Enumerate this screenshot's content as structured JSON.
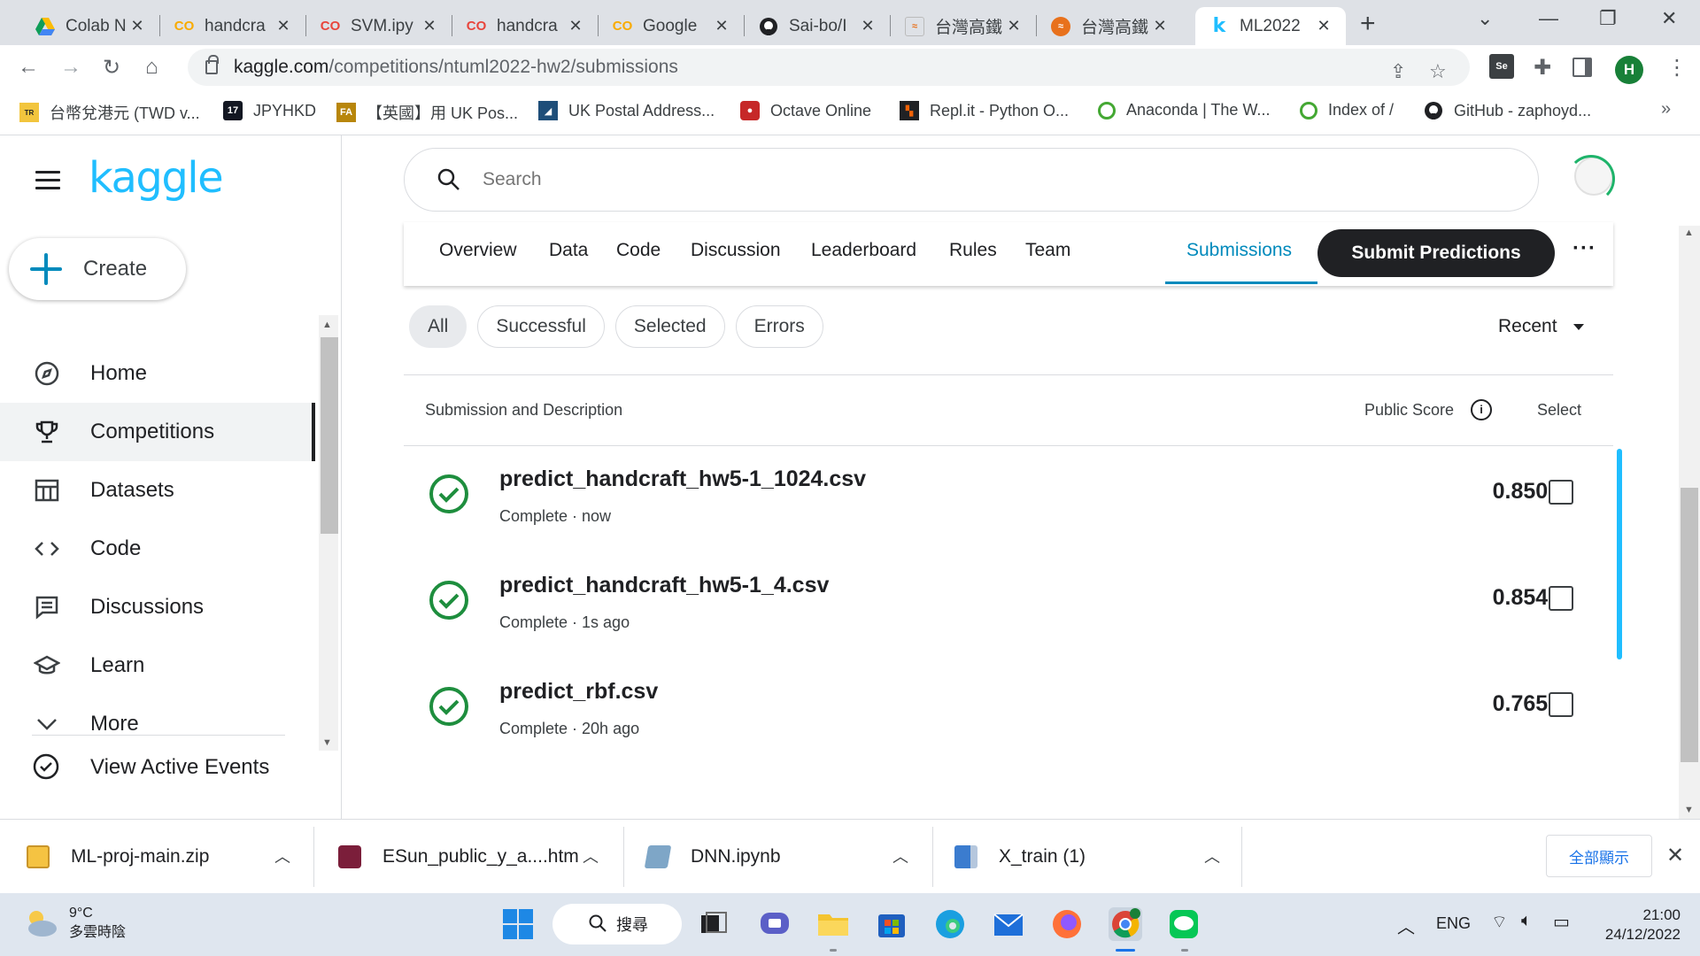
{
  "browser": {
    "tabs": [
      {
        "title": "Colab N",
        "icon": "google-drive-icon"
      },
      {
        "title": "handcra",
        "icon": "colab-icon"
      },
      {
        "title": "SVM.ipy",
        "icon": "colab-icon"
      },
      {
        "title": "handcra",
        "icon": "colab-icon"
      },
      {
        "title": "Google",
        "icon": "colab-icon"
      },
      {
        "title": "Sai-bo/I",
        "icon": "github-icon"
      },
      {
        "title": "台灣高鐵",
        "icon": "thsr-icon"
      },
      {
        "title": "台灣高鐵",
        "icon": "thsr-icon"
      },
      {
        "title": "ML2022",
        "icon": "kaggle-icon"
      }
    ],
    "url_host": "kaggle.com",
    "url_path": "/competitions/ntuml2022-hw2/submissions",
    "profile_initial": "H",
    "bookmarks": [
      {
        "label": "台幣兌港元 (TWD v...",
        "icon": "trade-icon"
      },
      {
        "label": "JPYHKD",
        "icon": "tradingview-icon"
      },
      {
        "label": "【英國】用 UK Pos...",
        "icon": "fa-icon"
      },
      {
        "label": "UK Postal Address...",
        "icon": "map-icon"
      },
      {
        "label": "Octave Online",
        "icon": "octave-icon"
      },
      {
        "label": "Repl.it - Python O...",
        "icon": "replit-icon"
      },
      {
        "label": "Anaconda | The W...",
        "icon": "anaconda-icon"
      },
      {
        "label": "Index of /",
        "icon": "anaconda-icon"
      },
      {
        "label": "GitHub - zaphoyd...",
        "icon": "github-icon"
      }
    ],
    "bookmarks_more": "»"
  },
  "sidebar": {
    "logo": "kaggle",
    "create_label": "Create",
    "items": [
      {
        "label": "Home",
        "icon": "compass-icon"
      },
      {
        "label": "Competitions",
        "icon": "trophy-icon",
        "active": true
      },
      {
        "label": "Datasets",
        "icon": "table-icon"
      },
      {
        "label": "Code",
        "icon": "code-icon"
      },
      {
        "label": "Discussions",
        "icon": "discussion-icon"
      },
      {
        "label": "Learn",
        "icon": "school-icon"
      },
      {
        "label": "More",
        "icon": "chevron-down-icon"
      }
    ],
    "events_label": "View Active Events"
  },
  "search": {
    "placeholder": "Search"
  },
  "competition_nav": {
    "tabs": [
      "Overview",
      "Data",
      "Code",
      "Discussion",
      "Leaderboard",
      "Rules",
      "Team",
      "Submissions"
    ],
    "active_tab": "Submissions",
    "submit_label": "Submit Predictions",
    "more_label": "···"
  },
  "filters": {
    "chips": [
      "All",
      "Successful",
      "Selected",
      "Errors"
    ],
    "active": "All",
    "sort_label": "Recent"
  },
  "table": {
    "col_submission": "Submission and Description",
    "col_score": "Public Score",
    "col_select": "Select",
    "rows": [
      {
        "filename": "predict_handcraft_hw5-1_1024.csv",
        "status": "Complete · now",
        "score": "0.85012",
        "selected": false
      },
      {
        "filename": "predict_handcraft_hw5-1_4.csv",
        "status": "Complete · 1s ago",
        "score": "0.85466",
        "selected": false
      },
      {
        "filename": "predict_rbf.csv",
        "status": "Complete · 20h ago",
        "score": "0.76584",
        "selected": false
      }
    ]
  },
  "downloads": {
    "items": [
      {
        "name": "ML-proj-main.zip",
        "icon": "zip-icon"
      },
      {
        "name": "ESun_public_y_a....htm",
        "icon": "html-file-icon"
      },
      {
        "name": "DNN.ipynb",
        "icon": "notebook-file-icon"
      },
      {
        "name": "X_train (1)",
        "icon": "spreadsheet-file-icon"
      }
    ],
    "show_all_label": "全部顯示"
  },
  "taskbar": {
    "temperature": "9°C",
    "weather_text": "多雲時陰",
    "search_label": "搜尋",
    "lang": "ENG",
    "time": "21:00",
    "date": "24/12/2022"
  },
  "colors": {
    "kaggle_blue": "#20beff",
    "accent": "#008abc",
    "success_green": "#1e8e3e",
    "submit_bg": "#202124"
  }
}
